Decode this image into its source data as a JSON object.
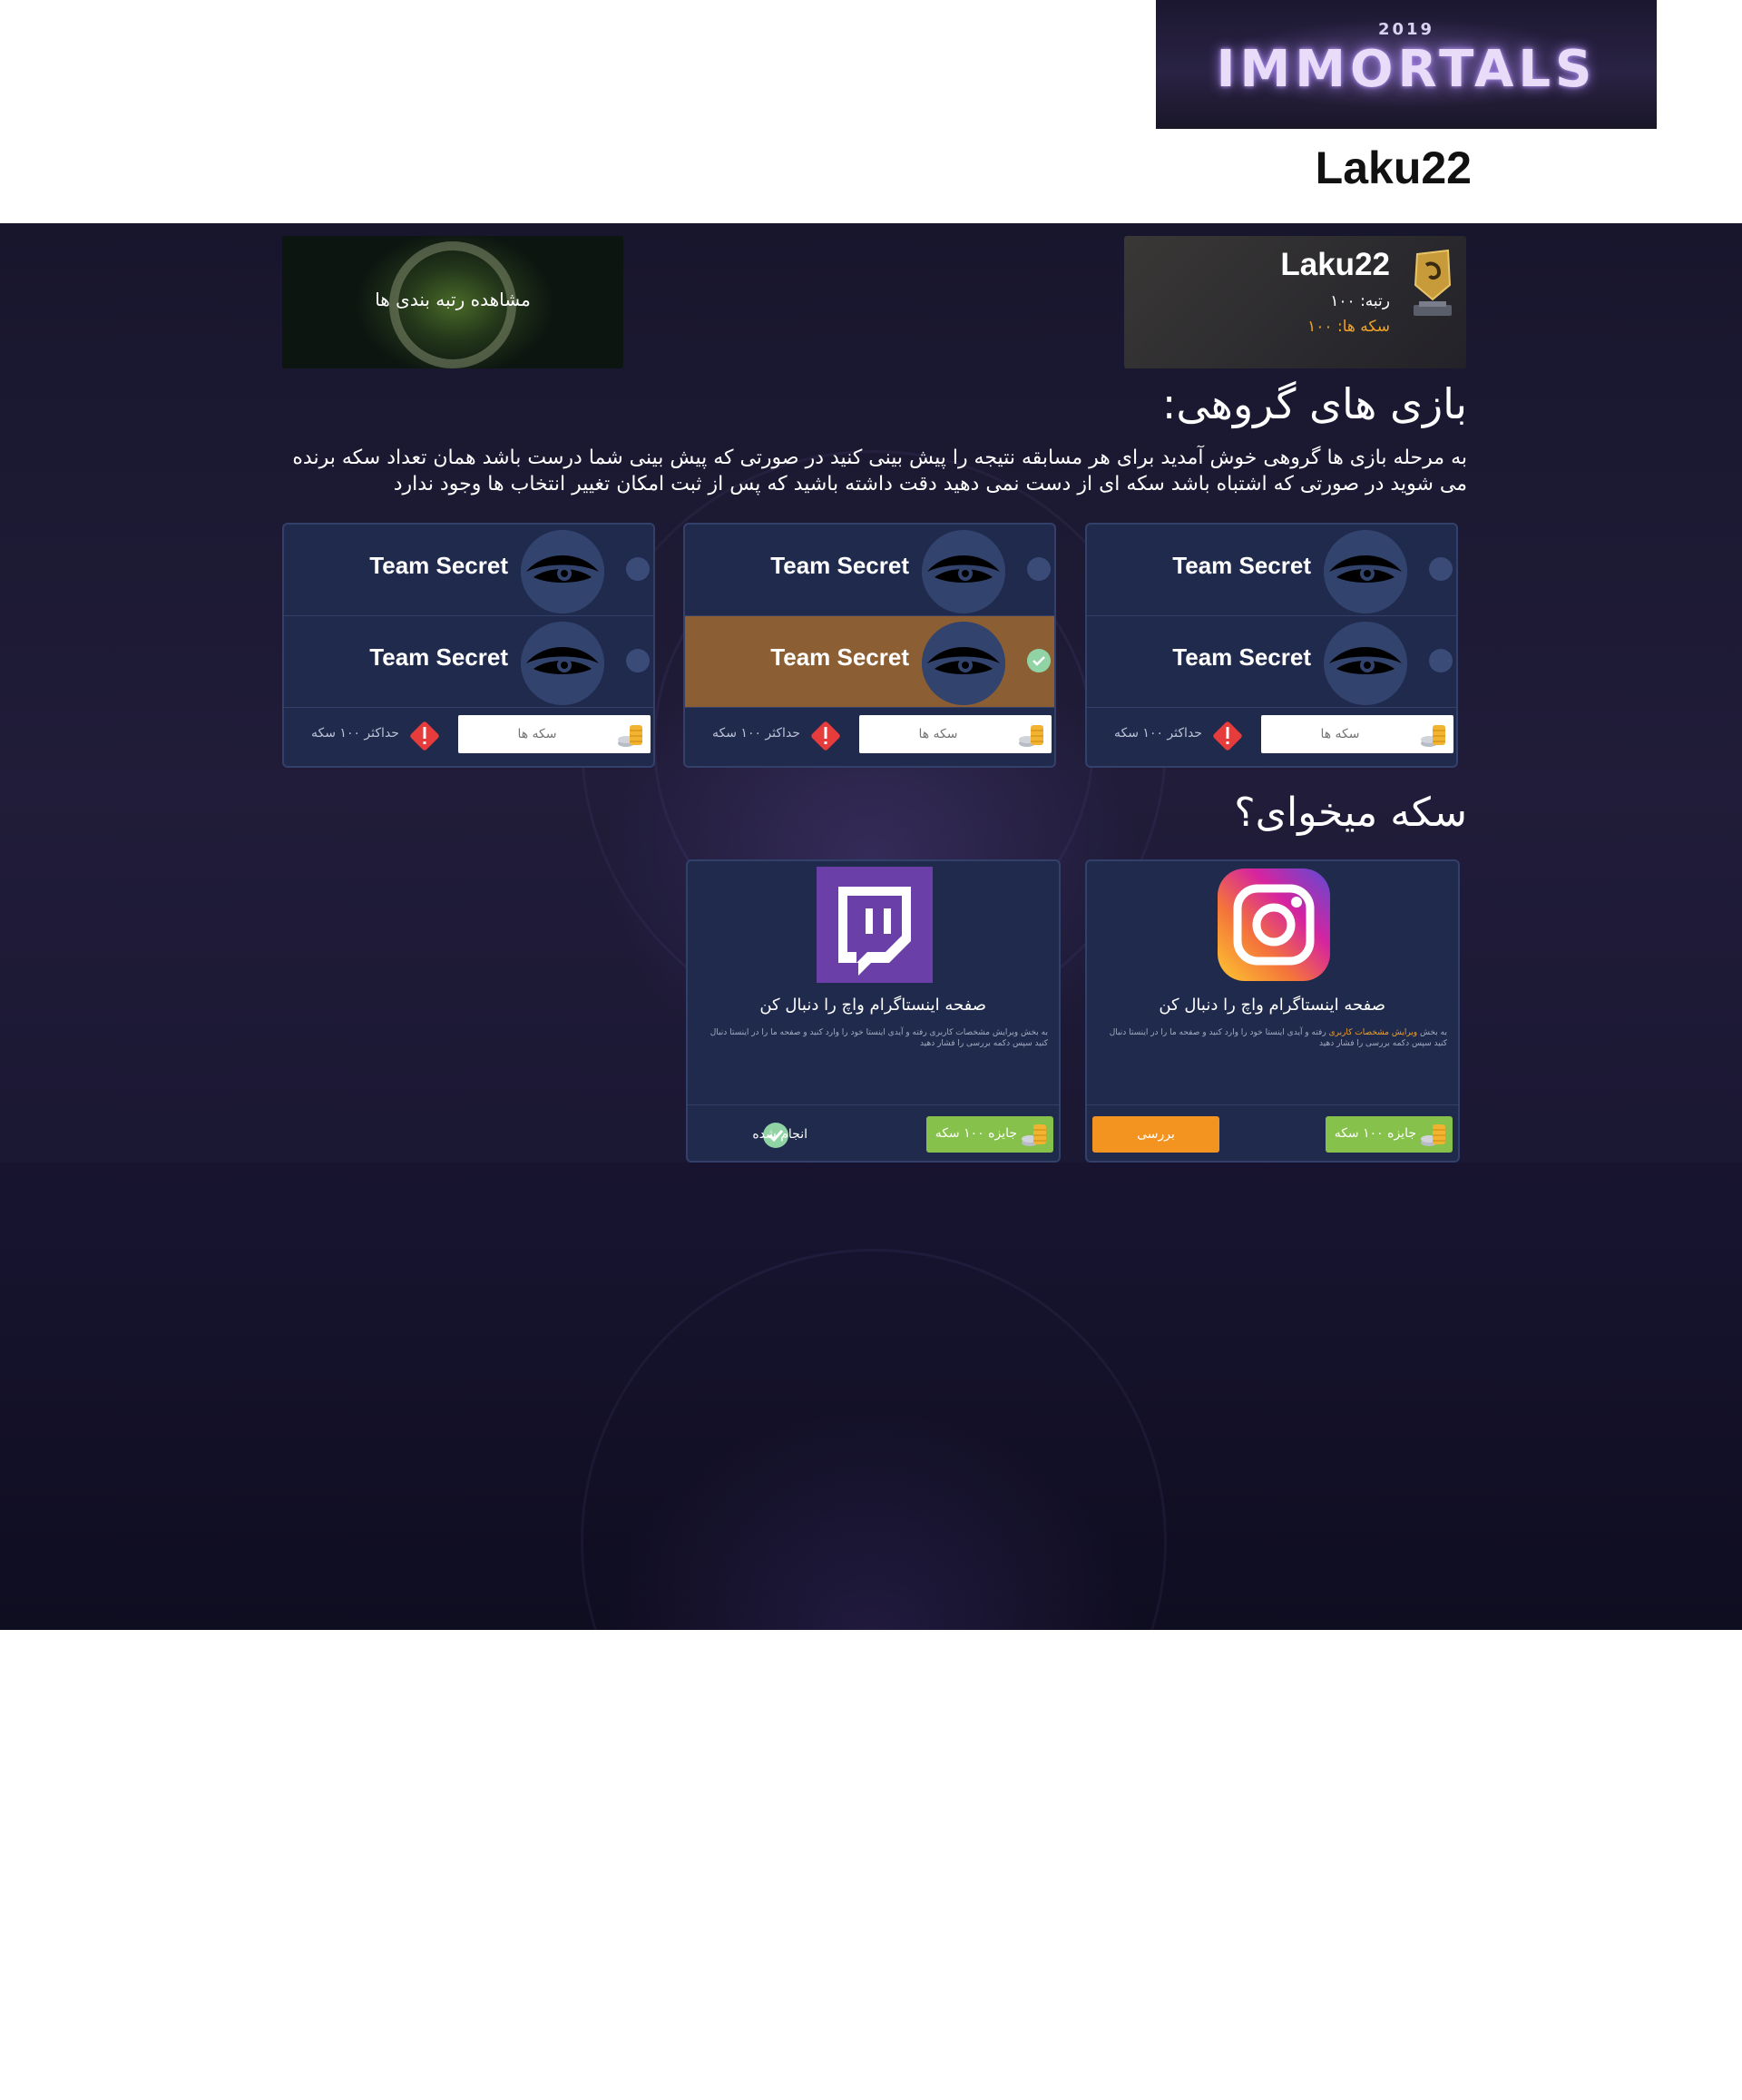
{
  "header": {
    "banner_year": "2019",
    "banner_title": "IMMORTALS",
    "username": "Laku22"
  },
  "profile": {
    "name": "Laku22",
    "rank": "رتبه: ۱۰۰",
    "coins": "سکه ها: ۱۰۰",
    "badge_icon": "aegis-badge-icon"
  },
  "ranking": {
    "label": "مشاهده رتبه بندی ها"
  },
  "group_games": {
    "heading": "بازی های گروهی:",
    "description": "به مرحله بازی ها گروهی خوش آمدید برای هر مسابقه نتیجه را پیش بینی کنید در صورتی که پیش بینی شما درست باشد همان تعداد سکه برنده می شوید در صورتی که اشتباه باشد سکه ای از دست نمی دهید دقت داشته باشید که پس از ثبت امکان تغییر انتخاب ها وجود ندارد",
    "matches": [
      {
        "team1": "Team Secret",
        "team2": "Team Secret",
        "selected": null,
        "placeholder": "سکه ها",
        "max": "حداکثر ۱۰۰ سکه"
      },
      {
        "team1": "Team Secret",
        "team2": "Team Secret",
        "selected": "team2",
        "placeholder": "سکه ها",
        "max": "حداکثر ۱۰۰ سکه"
      },
      {
        "team1": "Team Secret",
        "team2": "Team Secret",
        "selected": null,
        "placeholder": "سکه ها",
        "max": "حداکثر ۱۰۰ سکه"
      }
    ]
  },
  "earn_coins": {
    "heading": "سکه میخوای؟",
    "tasks": [
      {
        "icon": "instagram-icon",
        "title": "صفحه اینستاگرام واچ را دنبال کن",
        "desc_pre": "به بخش ",
        "desc_link": "ویرایش مشخصات کاربری",
        "desc_post": " رفته و آیدی اینستا خود را وارد کنید و صفحه ما را در اینستا دنبال کنید سپس دکمه بررسی را فشار دهید",
        "reward": "جایزه ۱۰۰ سکه",
        "action": "بررسی"
      },
      {
        "icon": "twitch-icon",
        "title": "صفحه اینستاگرام واچ را دنبال کن",
        "desc": "به بخش ویرایش مشخصات کاربری رفته و آیدی اینستا خود را وارد کنید و صفحه ما را در اینستا دنبال کنید سپس دکمه بررسی را فشار دهید",
        "reward": "جایزه ۱۰۰ سکه",
        "status": "انجام شده"
      }
    ]
  },
  "colors": {
    "card_bg": "#1f2a4c",
    "selected_bg": "#8c5e34",
    "reward_green": "#86c24b",
    "review_orange": "#f39420",
    "coin_orange": "#f0a22a",
    "warning_red": "#e63c3c"
  }
}
